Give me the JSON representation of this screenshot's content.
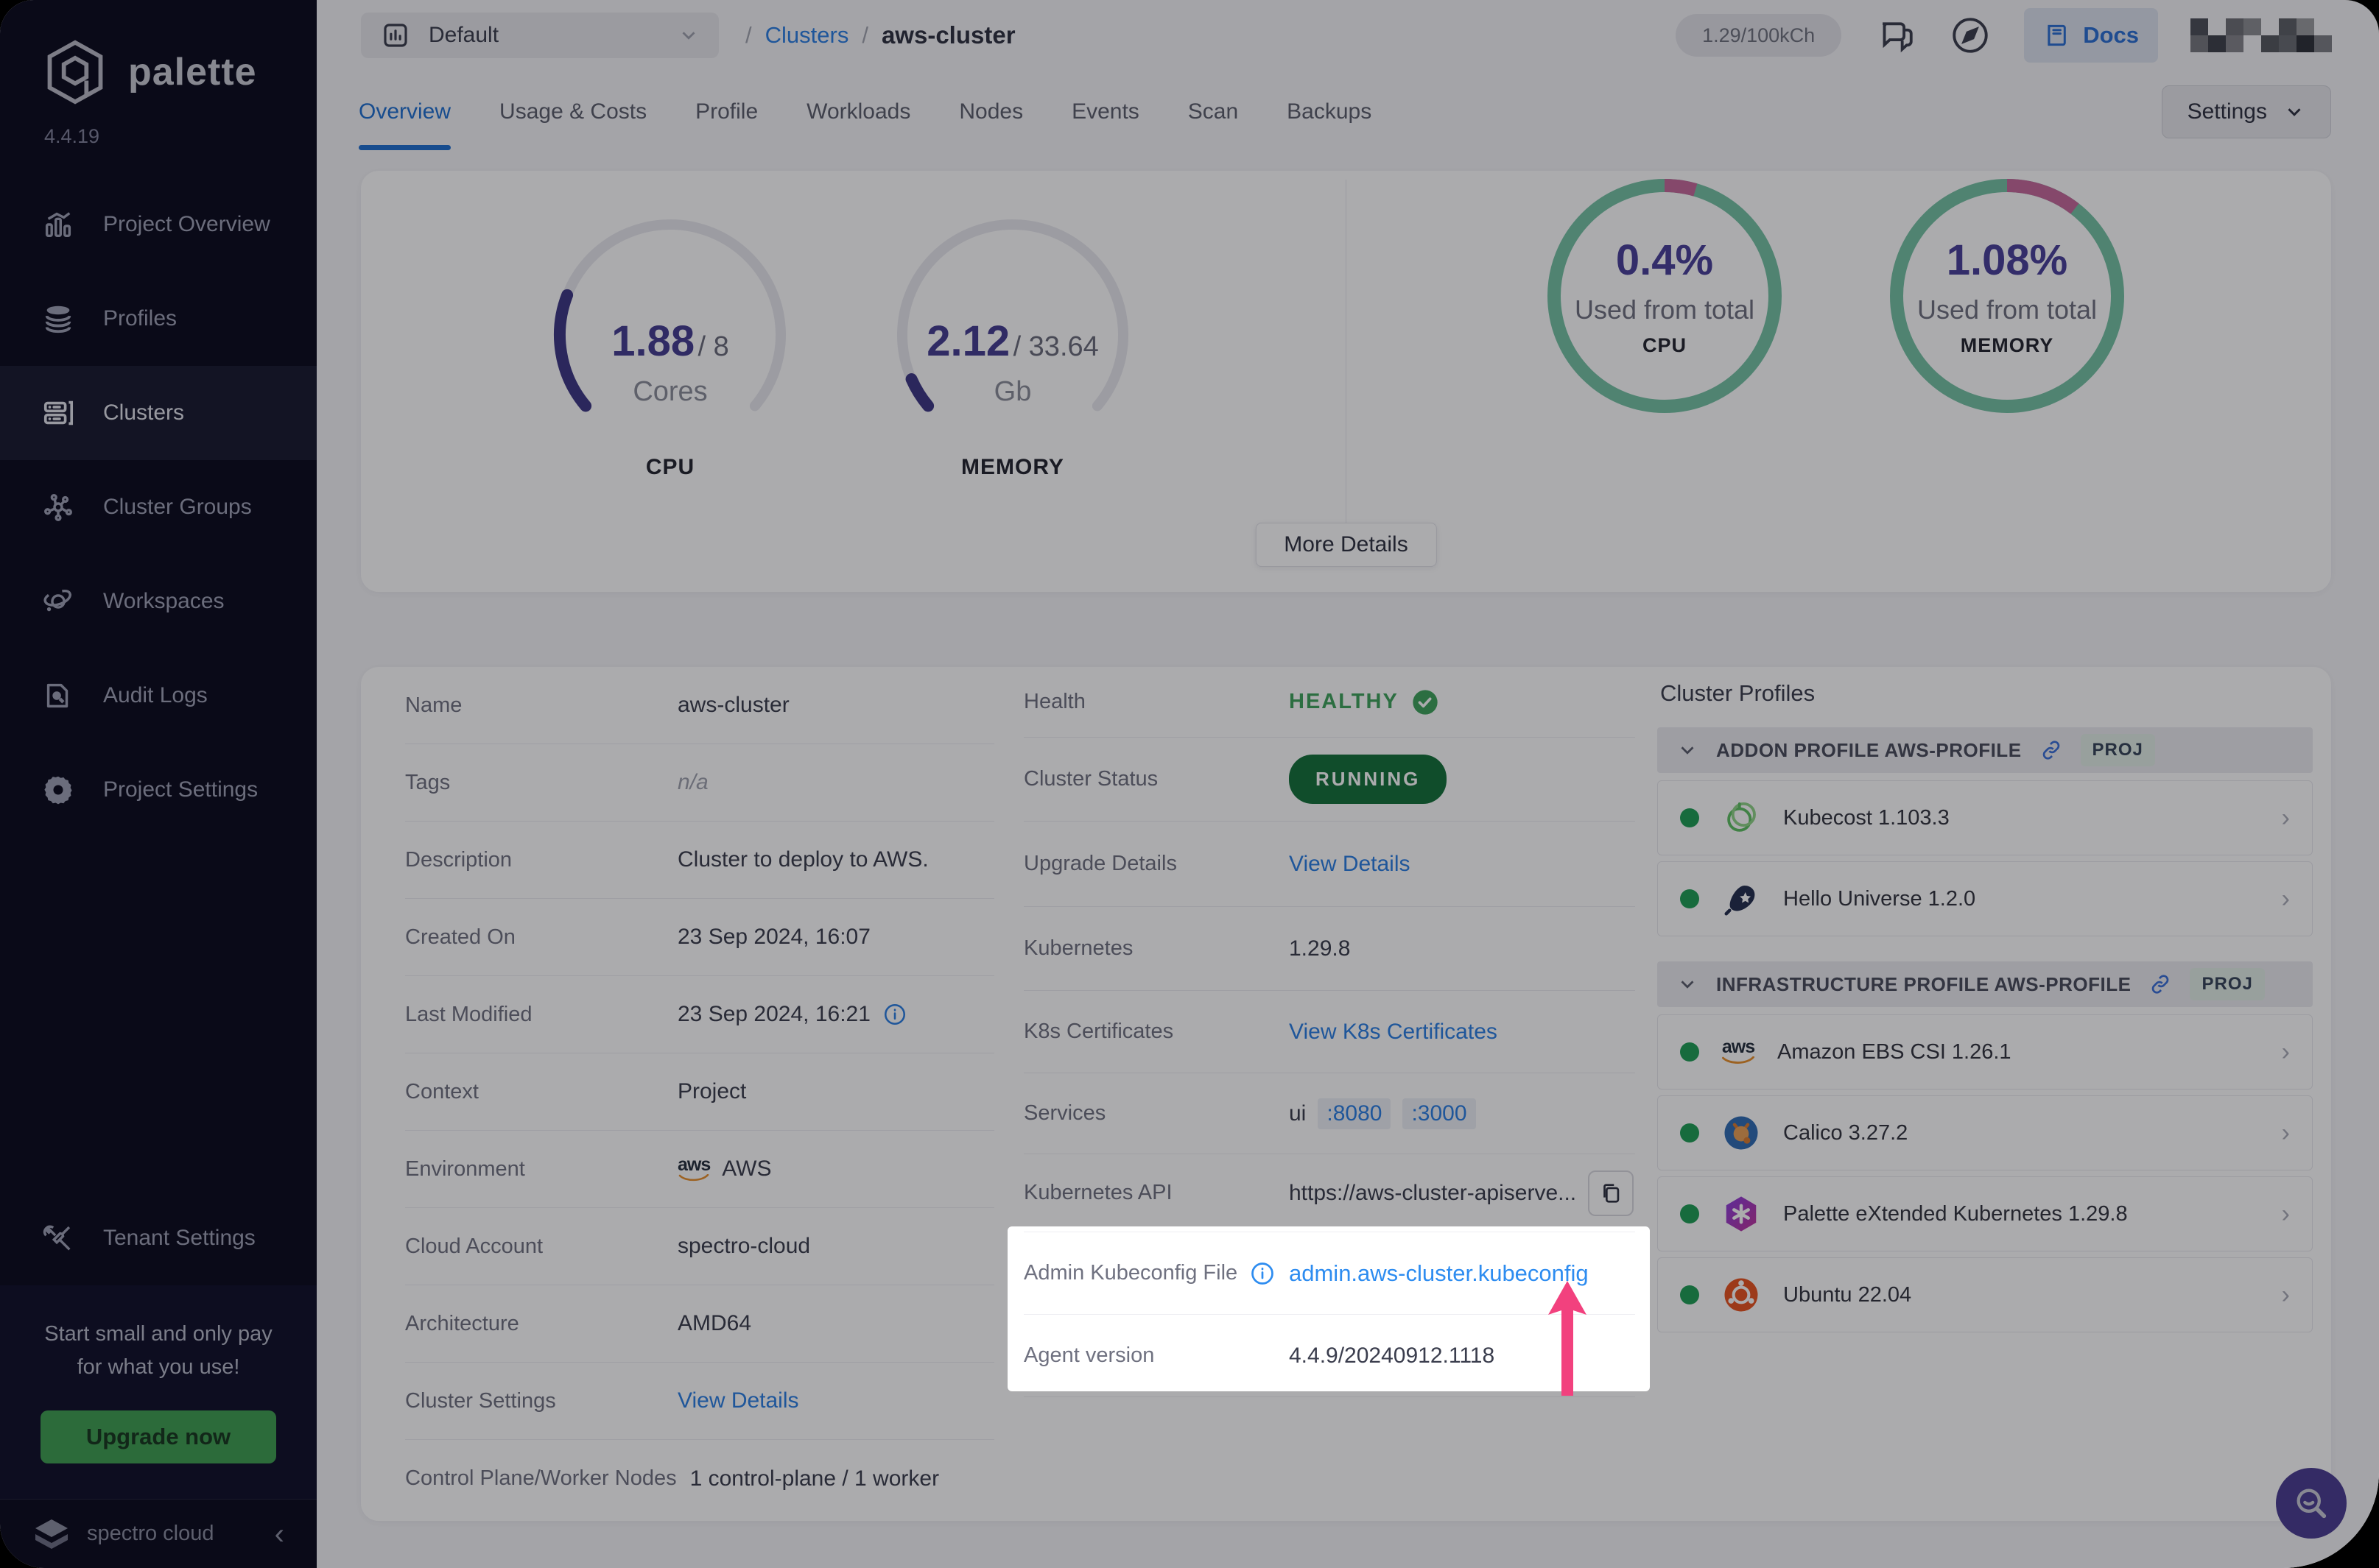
{
  "sidebar": {
    "logo": "palette",
    "version": "4.4.19",
    "items": [
      {
        "label": "Project Overview",
        "icon": "bar-chart-icon",
        "active": false
      },
      {
        "label": "Profiles",
        "icon": "layers-icon",
        "active": false
      },
      {
        "label": "Clusters",
        "icon": "server-rack-icon",
        "active": true
      },
      {
        "label": "Cluster Groups",
        "icon": "network-icon",
        "active": false
      },
      {
        "label": "Workspaces",
        "icon": "orbit-icon",
        "active": false
      },
      {
        "label": "Audit Logs",
        "icon": "doc-search-icon",
        "active": false
      },
      {
        "label": "Project Settings",
        "icon": "gear-icon",
        "active": false
      }
    ],
    "tenant": {
      "label": "Tenant Settings",
      "icon": "tools-icon"
    },
    "upsell": {
      "line1": "Start small and only pay",
      "line2": "for what you use!",
      "button": "Upgrade now"
    },
    "footer": {
      "brand": "spectro cloud"
    }
  },
  "topbar": {
    "project_selector": "Default",
    "breadcrumb": {
      "sep": "/",
      "root": "Clusters",
      "current": "aws-cluster"
    },
    "credits": "1.29/100kCh",
    "docs": "Docs"
  },
  "tabs": {
    "items": [
      "Overview",
      "Usage & Costs",
      "Profile",
      "Workloads",
      "Nodes",
      "Events",
      "Scan",
      "Backups"
    ],
    "active": "Overview",
    "settings_button": "Settings"
  },
  "stats": {
    "gauges": [
      {
        "value": "1.88",
        "total": "/ 8",
        "unit": "Cores",
        "label": "CPU",
        "fraction": 0.235
      },
      {
        "value": "2.12",
        "total": "/ 33.64",
        "unit": "Gb",
        "label": "MEMORY",
        "fraction": 0.063
      }
    ],
    "rings": [
      {
        "pct": "0.4%",
        "caption": "Used from total",
        "label": "CPU",
        "fraction": 0.045
      },
      {
        "pct": "1.08%",
        "caption": "Used from total",
        "label": "MEMORY",
        "fraction": 0.105
      }
    ],
    "more_button": "More Details"
  },
  "chart_data": [
    {
      "type": "gauge",
      "title": "CPU",
      "value": 1.88,
      "max": 8,
      "unit": "Cores"
    },
    {
      "type": "gauge",
      "title": "MEMORY",
      "value": 2.12,
      "max": 33.64,
      "unit": "Gb"
    },
    {
      "type": "donut",
      "title": "CPU",
      "value_pct": 0.4,
      "label": "Used from total"
    },
    {
      "type": "donut",
      "title": "MEMORY",
      "value_pct": 1.08,
      "label": "Used from total"
    }
  ],
  "details": {
    "left": [
      {
        "label": "Name",
        "value": "aws-cluster"
      },
      {
        "label": "Tags",
        "value": "n/a"
      },
      {
        "label": "Description",
        "value": "Cluster to deploy to AWS."
      },
      {
        "label": "Created On",
        "value": "23 Sep 2024, 16:07"
      },
      {
        "label": "Last Modified",
        "value": "23 Sep 2024, 16:21"
      },
      {
        "label": "Context",
        "value": "Project"
      },
      {
        "label": "Environment",
        "value": "AWS"
      },
      {
        "label": "Cloud Account",
        "value": "spectro-cloud"
      },
      {
        "label": "Architecture",
        "value": "AMD64"
      },
      {
        "label": "Cluster Settings",
        "value": "View Details"
      },
      {
        "label": "Control Plane/Worker Nodes",
        "value": "1 control-plane / 1 worker"
      }
    ],
    "mid": [
      {
        "label": "Health",
        "value": "HEALTHY"
      },
      {
        "label": "Cluster Status",
        "value": "RUNNING"
      },
      {
        "label": "Upgrade Details",
        "value": "View Details"
      },
      {
        "label": "Kubernetes",
        "value": "1.29.8"
      },
      {
        "label": "K8s Certificates",
        "value": "View K8s Certificates"
      },
      {
        "label": "Services",
        "value": "ui",
        "port1": ":8080",
        "port2": ":3000"
      },
      {
        "label": "Kubernetes API",
        "value": "https://aws-cluster-apiserve..."
      },
      {
        "label": "Admin Kubeconfig File",
        "value": "admin.aws-cluster.kubeconfig"
      },
      {
        "label": "Agent version",
        "value": "4.4.9/20240912.1118"
      }
    ],
    "env_logo_text": "aws"
  },
  "profiles": {
    "title": "Cluster Profiles",
    "groups": [
      {
        "title": "ADDON PROFILE AWS-PROFILE",
        "badge": "PROJ",
        "items": [
          {
            "name": "Kubecost 1.103.3",
            "icon": "kubecost-logo"
          },
          {
            "name": "Hello Universe 1.2.0",
            "icon": "hello-universe-logo"
          }
        ]
      },
      {
        "title": "INFRASTRUCTURE PROFILE AWS-PROFILE",
        "badge": "PROJ",
        "items": [
          {
            "name": "Amazon EBS CSI 1.26.1",
            "icon": "aws-logo"
          },
          {
            "name": "Calico 3.27.2",
            "icon": "calico-logo"
          },
          {
            "name": "Palette eXtended Kubernetes 1.29.8",
            "icon": "pxk-logo"
          },
          {
            "name": "Ubuntu 22.04",
            "icon": "ubuntu-logo"
          }
        ]
      }
    ]
  },
  "theme": {
    "accent_blue": "#2b7fe3",
    "active_tab_blue": "#1f6fd0",
    "gauge_indigo": "#3e3784",
    "ring_teal": "#76c2a5",
    "ring_pink": "#c56a9c",
    "healthy_green": "#3fa35c",
    "running_green": "#15713a",
    "upgrade_green": "#3f9f51",
    "tour_pink": "#f2417e",
    "fab_purple": "#4b3d92",
    "sidebar_bg": "#0c0c1e"
  }
}
